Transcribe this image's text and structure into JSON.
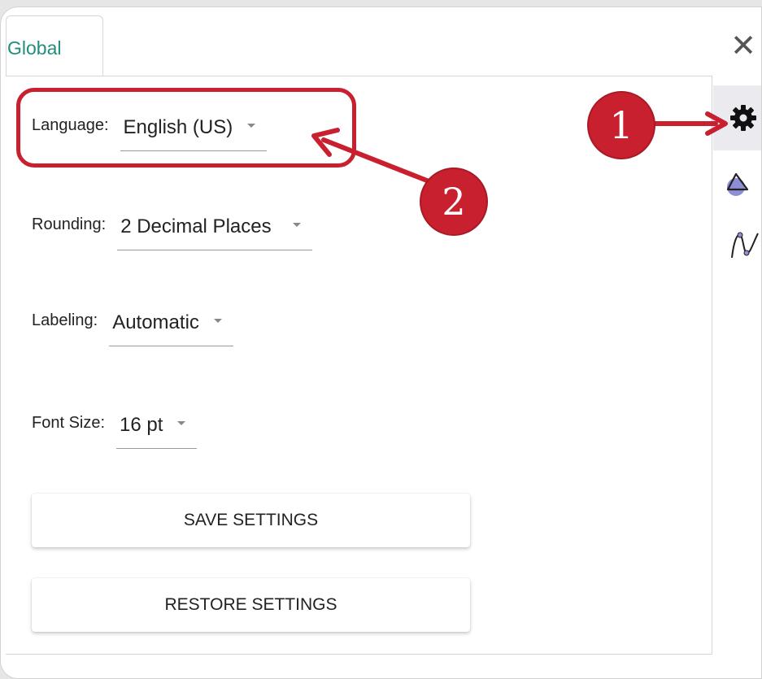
{
  "window": {
    "tab_label": "Global",
    "close_glyph": "✕"
  },
  "sidebar": {
    "items": [
      {
        "icon": "gear-icon",
        "active": true
      },
      {
        "icon": "geometry-shapes-icon",
        "active": false
      },
      {
        "icon": "graph-curve-icon",
        "active": false
      }
    ]
  },
  "form": {
    "language": {
      "label": "Language:",
      "value": "English (US)"
    },
    "rounding": {
      "label": "Rounding:",
      "value": "2 Decimal Places"
    },
    "labeling": {
      "label": "Labeling:",
      "value": "Automatic"
    },
    "font_size": {
      "label": "Font Size:",
      "value": "16 pt"
    }
  },
  "buttons": {
    "save": "SAVE SETTINGS",
    "restore": "RESTORE SETTINGS"
  },
  "annotations": {
    "badge_1": "1",
    "badge_2": "2",
    "color": "#c8202e"
  }
}
